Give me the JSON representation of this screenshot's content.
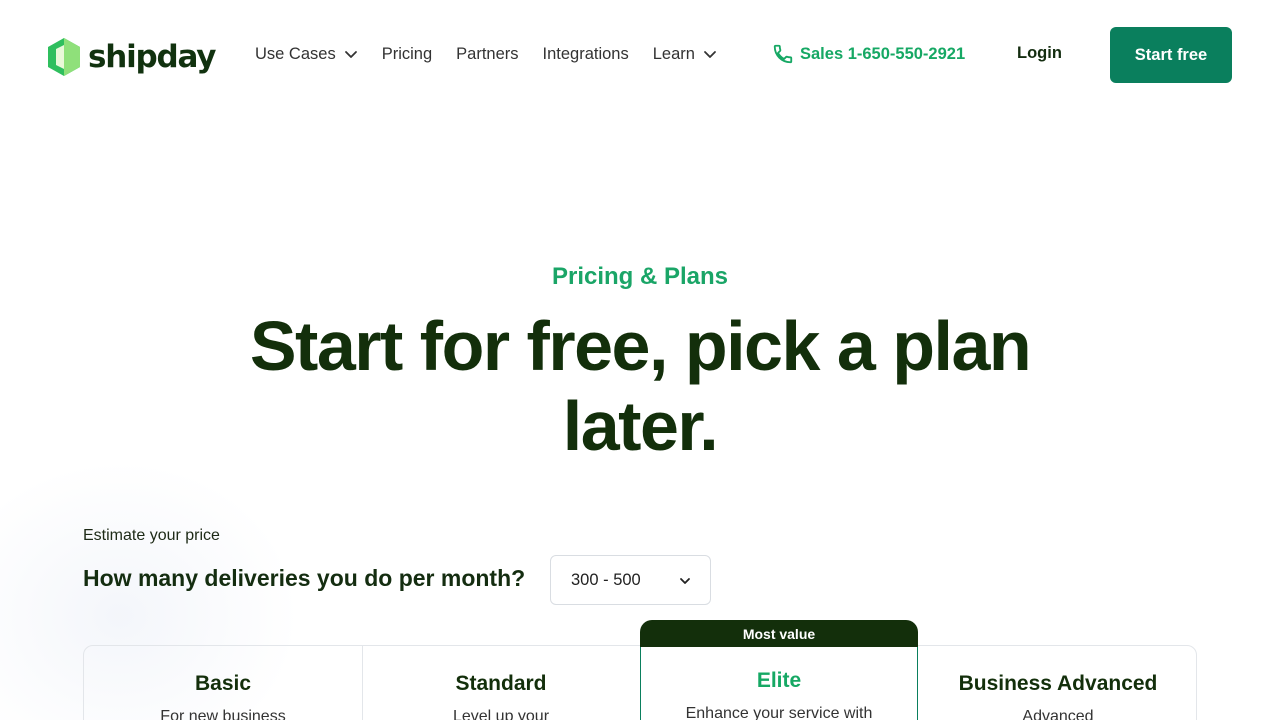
{
  "brand": {
    "name": "shipday",
    "colors": {
      "primary": "#0a7f5d",
      "accent": "#16a864",
      "dark": "#132f0b"
    }
  },
  "nav": {
    "items": [
      {
        "label": "Use Cases",
        "has_dropdown": true
      },
      {
        "label": "Pricing",
        "has_dropdown": false
      },
      {
        "label": "Partners",
        "has_dropdown": false
      },
      {
        "label": "Integrations",
        "has_dropdown": false
      },
      {
        "label": "Learn",
        "has_dropdown": true
      }
    ],
    "sales_label": "Sales 1-650-550-2921",
    "sales_icon": "phone-icon",
    "login_label": "Login",
    "cta_label": "Start free"
  },
  "hero": {
    "eyebrow": "Pricing & Plans",
    "headline_line1": "Start for free, pick a plan",
    "headline_line2": "later."
  },
  "estimate": {
    "label": "Estimate your price",
    "question": "How many deliveries you do per month?",
    "selected_value": "300 - 500"
  },
  "plans": [
    {
      "name": "Basic",
      "description": "For new business"
    },
    {
      "name": "Standard",
      "description": "Level up your"
    },
    {
      "name": "Elite",
      "description": "Enhance your service with",
      "badge": "Most value"
    },
    {
      "name": "Business Advanced",
      "description": "Advanced"
    }
  ]
}
